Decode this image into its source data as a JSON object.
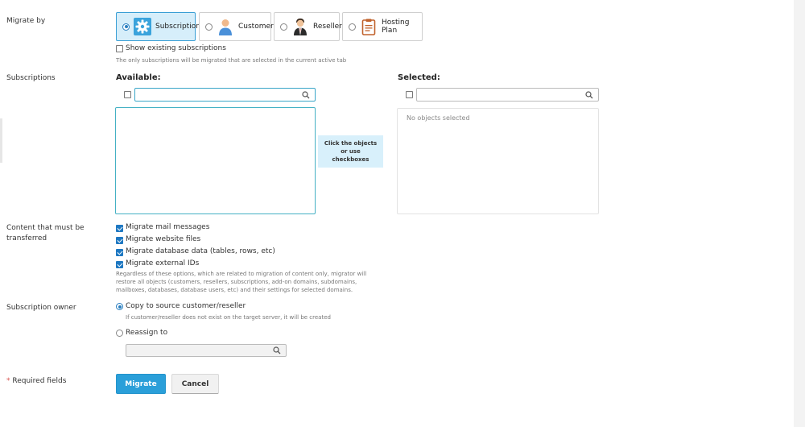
{
  "migrate_by": {
    "label": "Migrate by",
    "tabs": [
      {
        "label": "Subscription",
        "icon": "gear-icon",
        "selected": true
      },
      {
        "label": "Customer",
        "icon": "customer-avatar-icon",
        "selected": false
      },
      {
        "label": "Reseller",
        "icon": "reseller-avatar-icon",
        "selected": false
      },
      {
        "label": "Hosting Plan",
        "icon": "clipboard-icon",
        "selected": false
      }
    ],
    "show_existing_label": "Show existing subscriptions",
    "show_existing_hint": "The only subscriptions will be migrated that are selected in the current active tab"
  },
  "subscriptions": {
    "label": "Subscriptions",
    "available_heading": "Available:",
    "selected_heading": "Selected:",
    "transfer_hint": "Click the objects or use checkboxes",
    "empty_selected": "No objects selected"
  },
  "content": {
    "label": "Content that must be transferred",
    "options": [
      {
        "label": "Migrate mail messages",
        "checked": true
      },
      {
        "label": "Migrate website files",
        "checked": true
      },
      {
        "label": "Migrate database data (tables, rows, etc)",
        "checked": true
      },
      {
        "label": "Migrate external IDs",
        "checked": true
      }
    ],
    "hint": "Regardless of these options, which are related to migration of content only, migrator will restore all objects (customers, resellers, subscriptions, add-on domains, subdomains, mailboxes, databases, database users, etc) and their settings for selected domains."
  },
  "owner": {
    "label": "Subscription owner",
    "copy_label": "Copy to source customer/reseller",
    "copy_hint": "If customer/reseller does not exist on the target server, it will be created",
    "reassign_label": "Reassign to"
  },
  "footer": {
    "required_star": "*",
    "required_label": "Required fields",
    "migrate_button": "Migrate",
    "cancel_button": "Cancel"
  },
  "colors": {
    "primary_button": "#2a9fd9",
    "selected_tab": "#d6eefa",
    "transfer_hint_bg": "#d8f0fb"
  }
}
